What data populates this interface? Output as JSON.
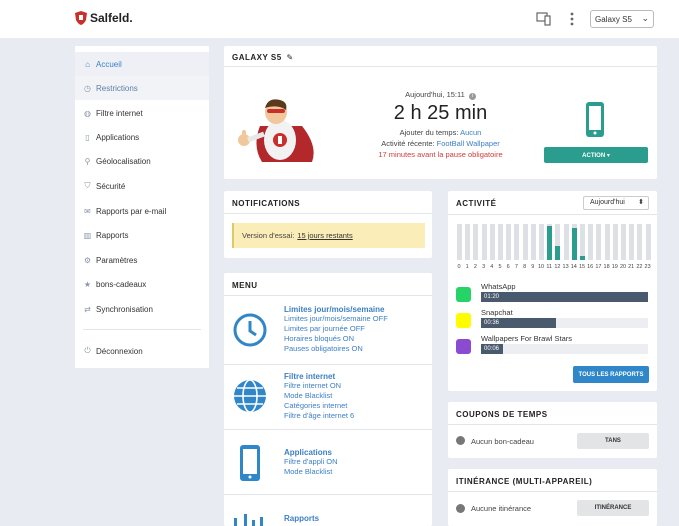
{
  "header": {
    "logo_text": "Salfeld.",
    "device_selected": "Galaxy S5"
  },
  "sidebar": {
    "items": [
      {
        "label": "Accueil",
        "icon": "home-icon"
      },
      {
        "label": "Restrictions",
        "icon": "clock-icon"
      },
      {
        "label": "Filtre internet",
        "icon": "globe-icon"
      },
      {
        "label": "Applications",
        "icon": "mobile-icon"
      },
      {
        "label": "Géolocalisation",
        "icon": "map-pin-icon"
      },
      {
        "label": "Sécurité",
        "icon": "shield-icon"
      },
      {
        "label": "Rapports par e-mail",
        "icon": "envelope-icon"
      },
      {
        "label": "Rapports",
        "icon": "bar-chart-icon"
      },
      {
        "label": "Paramètres",
        "icon": "gear-icon"
      },
      {
        "label": "bons-cadeaux",
        "icon": "star-icon"
      },
      {
        "label": "Synchronisation",
        "icon": "sync-icon"
      }
    ],
    "logout": {
      "label": "Déconnexion",
      "icon": "power-icon"
    }
  },
  "device_panel": {
    "title": "GALAXY S5",
    "today_label": "Aujourd'hui, 15:11",
    "time_used": "2 h 25 min",
    "add_time_label": "Ajouter du temps:",
    "add_time_value": "Aucun",
    "recent_activity_label": "Activité récente:",
    "recent_activity_value": "FootBall Wallpaper",
    "pause_notice": "17 minutes avant la pause obligatoire",
    "action_button": "ACTION ▾"
  },
  "notifications": {
    "title": "NOTIFICATIONS",
    "trial_label": "Version d'essai:",
    "trial_link": "15 jours restants"
  },
  "menu": {
    "title": "MENU",
    "sections": [
      {
        "title": "Limites jour/mois/semaine",
        "lines": [
          "Limites jour/mois/semaine OFF",
          "Limites par journée OFF",
          "Horaires bloqués ON",
          "Pauses obligatoires ON"
        ]
      },
      {
        "title": "Filtre internet",
        "lines": [
          "Filtre internet ON",
          "Mode Blacklist",
          "Catégories internet",
          "Filtre d'âge internet 6"
        ]
      },
      {
        "title": "Applications",
        "lines": [
          "Filtre d'appli ON",
          "Mode Blacklist"
        ]
      },
      {
        "title": "Rapports",
        "lines": []
      }
    ]
  },
  "activity": {
    "title": "ACTIVITÉ",
    "period": "Aujourd'hui",
    "hours": [
      "0",
      "1",
      "2",
      "3",
      "4",
      "5",
      "6",
      "7",
      "8",
      "9",
      "10",
      "11",
      "12",
      "13",
      "14",
      "15",
      "16",
      "17",
      "18",
      "19",
      "20",
      "21",
      "22",
      "23"
    ],
    "usage_fraction": [
      0,
      0,
      0,
      0,
      0,
      0,
      0,
      0,
      0,
      0,
      0,
      0.95,
      0.4,
      0,
      0.9,
      0.1,
      0,
      0,
      0,
      0,
      0,
      0,
      0,
      0
    ],
    "apps": [
      {
        "name": "WhatsApp",
        "time": "01:20",
        "fraction": 1.0,
        "icon": "whatsapp-icon"
      },
      {
        "name": "Snapchat",
        "time": "00:36",
        "fraction": 0.45,
        "icon": "snapchat-icon"
      },
      {
        "name": "Wallpapers For Brawl Stars",
        "time": "00:06",
        "fraction": 0.12,
        "icon": "wallpaper-app-icon"
      }
    ],
    "all_reports_button": "TOUS LES RAPPORTS"
  },
  "coupons": {
    "title": "COUPONS DE TEMPS",
    "status": "Aucun bon-cadeau",
    "button": "TANS"
  },
  "roaming": {
    "title": "ITINÉRANCE (MULTI-APPAREIL)",
    "status": "Aucune itinérance",
    "button": "ITINÉRANCE"
  },
  "colors": {
    "accent_blue": "#3d7fc6",
    "teal": "#2a9d8f",
    "warning_bg": "#faedb8",
    "alert_red": "#d23b3b"
  }
}
